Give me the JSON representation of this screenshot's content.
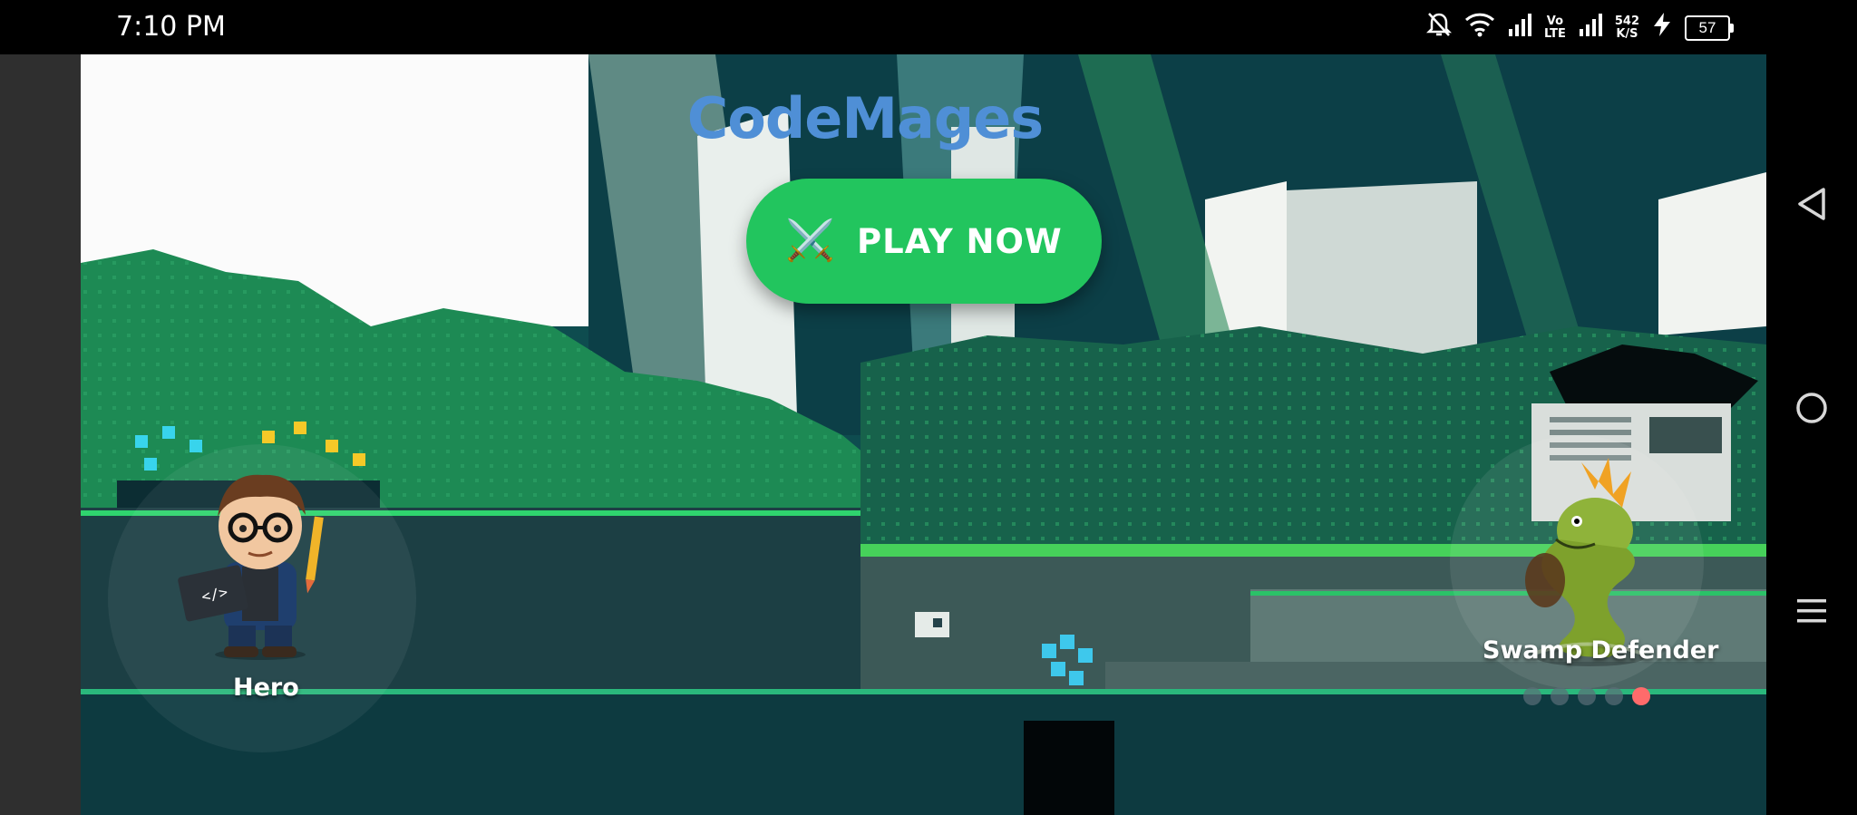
{
  "status_bar": {
    "time": "7:10 PM",
    "icons": [
      "bell-off-icon",
      "wifi-icon",
      "signal-icon",
      "volte-icon",
      "signal-icon",
      "data-speed",
      "charging-icon",
      "battery-icon"
    ],
    "volte_top": "Vo",
    "volte_bottom": "LTE",
    "data_speed_value": "542",
    "data_speed_unit": "K/S",
    "battery_level": "57"
  },
  "game": {
    "title": "CodeMages",
    "play_button": {
      "icon": "⚔️",
      "label": "PLAY NOW"
    },
    "hero": {
      "label": "Hero"
    },
    "enemy": {
      "label": "Swamp Defender"
    },
    "carousel": {
      "total": 5,
      "active_index": 4
    }
  },
  "nav_bar": {
    "back": "back-icon",
    "home": "home-icon",
    "menu": "menu-icon"
  },
  "colors": {
    "play_button": "#22c55e",
    "title": "#4f8fd6",
    "active_dot": "#ff6b6b"
  }
}
